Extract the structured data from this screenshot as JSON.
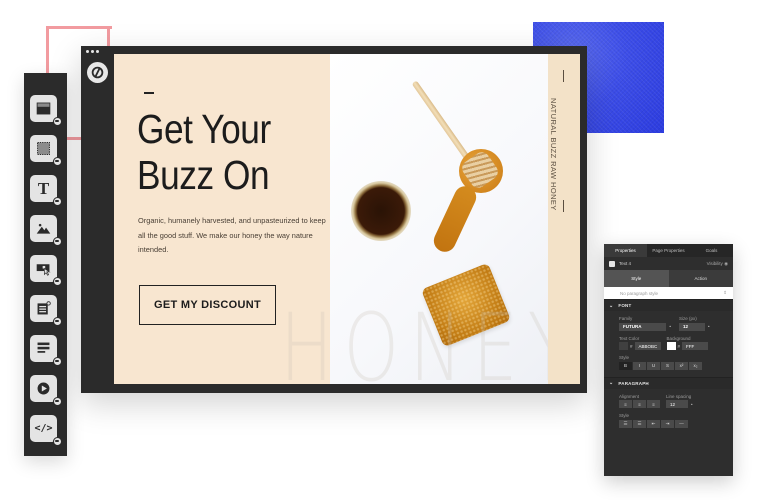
{
  "toolbar": {
    "tools": [
      {
        "name": "section",
        "icon": "section-icon"
      },
      {
        "name": "box",
        "icon": "box-icon"
      },
      {
        "name": "text",
        "icon": "text-icon",
        "glyph": "T"
      },
      {
        "name": "image",
        "icon": "image-icon"
      },
      {
        "name": "button",
        "icon": "button-icon"
      },
      {
        "name": "form",
        "icon": "form-icon"
      },
      {
        "name": "list",
        "icon": "list-icon"
      },
      {
        "name": "video",
        "icon": "video-icon"
      },
      {
        "name": "custom-html",
        "icon": "code-icon",
        "glyph": "</>"
      }
    ]
  },
  "canvas": {
    "headline_line1": "Get Your",
    "headline_line2": "Buzz On",
    "body": "Organic, humanely harvested, and unpasteurized to keep all the good stuff. We make our honey the way nature intended.",
    "cta": "GET MY DISCOUNT",
    "side_text": "NATURAL BUZZ RAW HONEY",
    "watermark": "HONEY"
  },
  "properties": {
    "tabs": [
      "Properties",
      "Page Properties",
      "Goals"
    ],
    "active_tab": "Properties",
    "element_name": "Text 4",
    "visibility_label": "Visibility",
    "visibility_icon": "eye-icon",
    "subtabs": [
      "Style",
      "Action"
    ],
    "active_subtab": "Style",
    "paragraph_style": "No paragraph style",
    "paragraph_style_arrow": "⇕",
    "font": {
      "section": "FONT",
      "family_label": "Family",
      "family_value": "FUTURA",
      "size_label": "Size (px)",
      "size_value": "12",
      "text_color_label": "Text Color",
      "text_color_value": "ABBOBC",
      "background_label": "Background",
      "background_value": "FFF",
      "style_label": "Style",
      "style_buttons": [
        "B",
        "I",
        "U",
        "S",
        "x²",
        "x₂"
      ]
    },
    "paragraph": {
      "section": "PARAGRAPH",
      "alignment_label": "Alignment",
      "alignment_buttons": [
        "≡",
        "≡",
        "≡"
      ],
      "line_spacing_label": "Line spacing",
      "line_spacing_value": "12",
      "style_label": "Style",
      "style_buttons": [
        "☰",
        "☰",
        "⇤",
        "⇥",
        "—"
      ]
    }
  },
  "colors": {
    "canvas_bg": "#f8e6d0",
    "editor_dark": "#2b2b2b",
    "accent_blue": "#3c4de8",
    "accent_pink": "#f29ba0",
    "honey": "#c97a14"
  }
}
